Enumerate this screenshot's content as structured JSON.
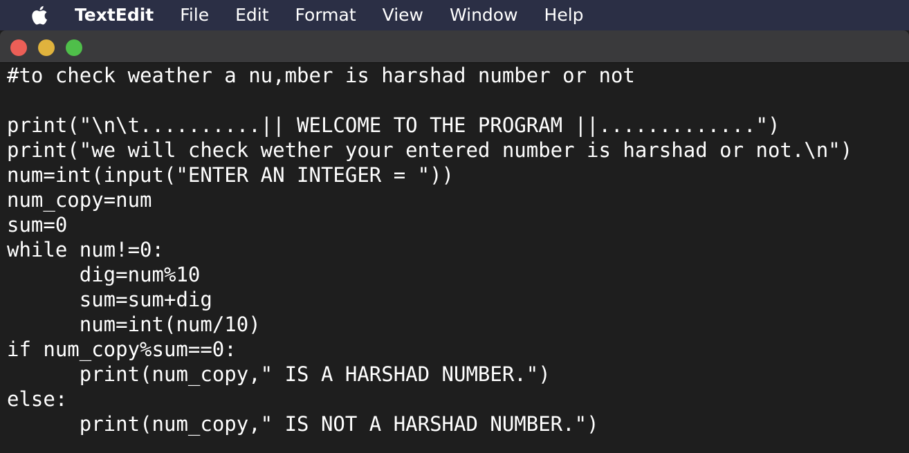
{
  "menubar": {
    "apple_icon": "apple-icon",
    "app_name": "TextEdit",
    "items": [
      "File",
      "Edit",
      "Format",
      "View",
      "Window",
      "Help"
    ]
  },
  "window": {
    "traffic_lights": {
      "close_color": "#ec5f57",
      "minimize_color": "#e0b33d",
      "zoom_color": "#4fbf4a"
    }
  },
  "document": {
    "lines": [
      "#to check weather a nu,mber is harshad number or not",
      "",
      "print(\"\\n\\t..........|| WELCOME TO THE PROGRAM ||.............\")",
      "print(\"we will check wether your entered number is harshad or not.\\n\")",
      "num=int(input(\"ENTER AN INTEGER = \"))",
      "num_copy=num",
      "sum=0",
      "while num!=0:",
      "\tdig=num%10",
      "\tsum=sum+dig",
      "\tnum=int(num/10)",
      "if num_copy%sum==0:",
      "\tprint(num_copy,\" IS A HARSHAD NUMBER.\")",
      "else:",
      "\tprint(num_copy,\" IS NOT A HARSHAD NUMBER.\")"
    ]
  }
}
